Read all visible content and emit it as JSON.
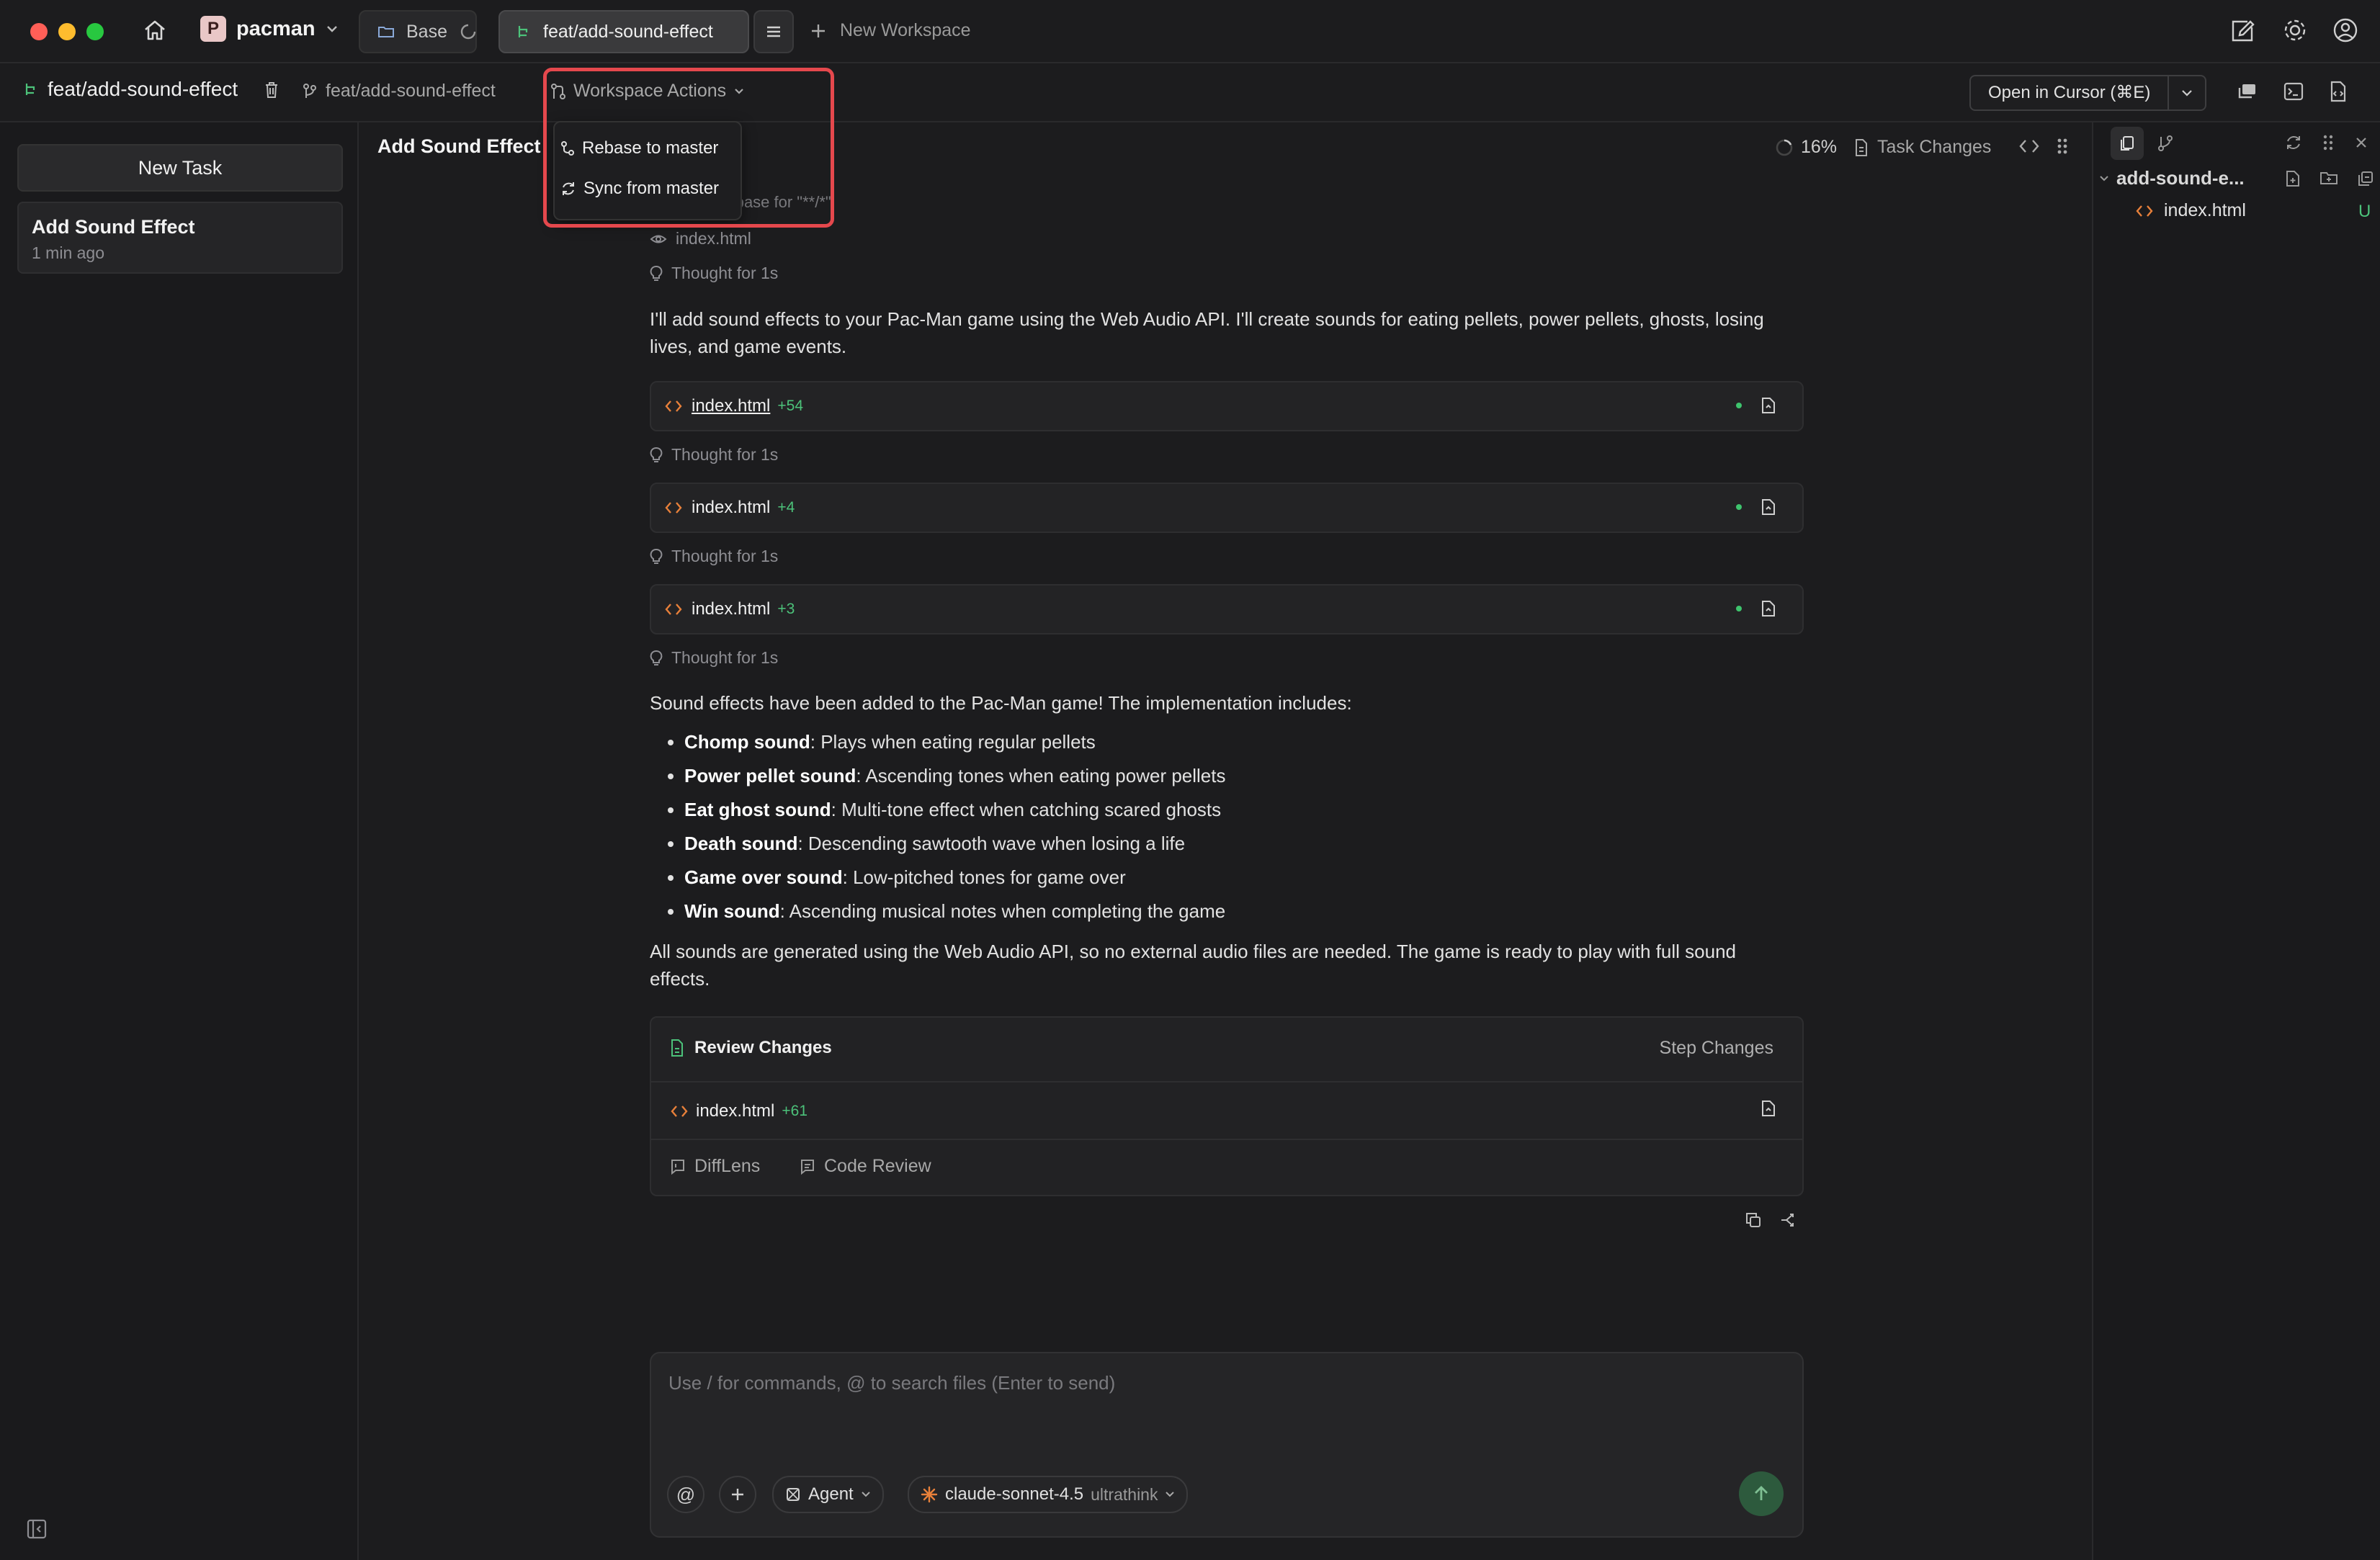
{
  "titlebar": {
    "project": "pacman",
    "project_initial": "P",
    "tabs": [
      {
        "label": "Base"
      },
      {
        "label": "feat/add-sound-effect"
      }
    ],
    "new_workspace": "New Workspace"
  },
  "subbar": {
    "branch": "feat/add-sound-effect",
    "base_branch": "feat/add-sound-effect",
    "workspace_actions": "Workspace Actions",
    "open_in": "Open in Cursor (⌘E)"
  },
  "menu": {
    "items": [
      "Rebase to master",
      "Sync from master"
    ]
  },
  "sidebar": {
    "new_task": "New Task",
    "tasks": [
      {
        "title": "Add Sound Effect",
        "time": "1 min ago"
      }
    ]
  },
  "main": {
    "title": "Add Sound Effect",
    "progress": "16%",
    "task_changes": "Task Changes",
    "search_text": "l codebase for \"**/*\"",
    "viewed_file": "index.html",
    "thoughts": [
      "Thought for 1s",
      "Thought for 1s",
      "Thought for 1s",
      "Thought for 1s"
    ],
    "intro": "I'll add sound effects to your Pac-Man game using the Web Audio API. I'll create sounds for eating pellets, power pellets, ghosts, losing lives, and game events.",
    "file_edits": [
      {
        "name": "index.html",
        "added": "+54"
      },
      {
        "name": "index.html",
        "added": "+4"
      },
      {
        "name": "index.html",
        "added": "+3"
      }
    ],
    "summary_intro": "Sound effects have been added to the Pac-Man game! The implementation includes:",
    "bullets": [
      {
        "term": "Chomp sound",
        "desc": ": Plays when eating regular pellets"
      },
      {
        "term": "Power pellet sound",
        "desc": ": Ascending tones when eating power pellets"
      },
      {
        "term": "Eat ghost sound",
        "desc": ": Multi-tone effect when catching scared ghosts"
      },
      {
        "term": "Death sound",
        "desc": ": Descending sawtooth wave when losing a life"
      },
      {
        "term": "Game over sound",
        "desc": ": Low-pitched tones for game over"
      },
      {
        "term": "Win sound",
        "desc": ": Ascending musical notes when completing the game"
      }
    ],
    "closing": "All sounds are generated using the Web Audio API, so no external audio files are needed. The game is ready to play with full sound effects.",
    "review": {
      "title": "Review Changes",
      "step_changes": "Step Changes",
      "file": "index.html",
      "added": "+61",
      "difflens": "DiffLens",
      "code_review": "Code Review"
    }
  },
  "composer": {
    "placeholder": "Use / for commands, @ to search files (Enter to send)",
    "agent": "Agent",
    "model": "claude-sonnet-4.5",
    "mode": "ultrathink"
  },
  "rightpanel": {
    "folder": "add-sound-e...",
    "file": "index.html",
    "file_status": "U"
  },
  "colors": {
    "accent_green": "#4cc27a",
    "highlight_red": "#e5484d",
    "file_icon_orange": "#e8803a"
  }
}
